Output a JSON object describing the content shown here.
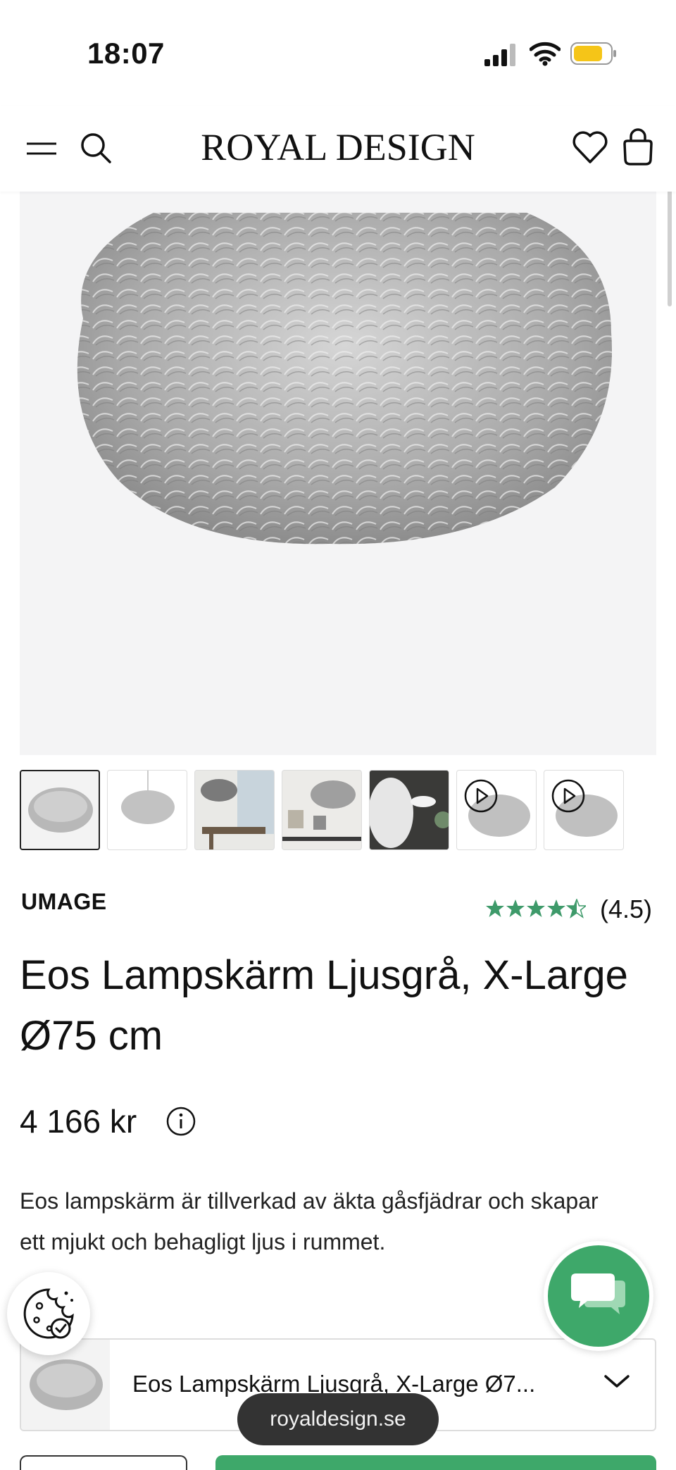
{
  "status_bar": {
    "time": "18:07"
  },
  "header": {
    "logo": "ROYAL DESIGN"
  },
  "product": {
    "brand": "UMAGE",
    "rating": "(4.5)",
    "title": "Eos Lampskärm Ljusgrå, X-Large Ø75 cm",
    "price": "4 166 kr",
    "description": "Eos lampskärm är tillverkad av äkta gåsfjädrar och skapar ett mjukt och behagligt ljus i rummet."
  },
  "variant_selector": {
    "label": "Eos Lampskärm Ljusgrå, X-Large Ø7..."
  },
  "browser": {
    "url": "royaldesign.se"
  },
  "colors": {
    "accent": "#3ea86a",
    "star": "#3e9a6a",
    "text": "#111111"
  },
  "icons": [
    "menu-icon",
    "search-icon",
    "heart-icon",
    "bag-icon",
    "info-icon",
    "cookie-icon",
    "chat-icon",
    "chevron-down-icon",
    "play-icon"
  ]
}
